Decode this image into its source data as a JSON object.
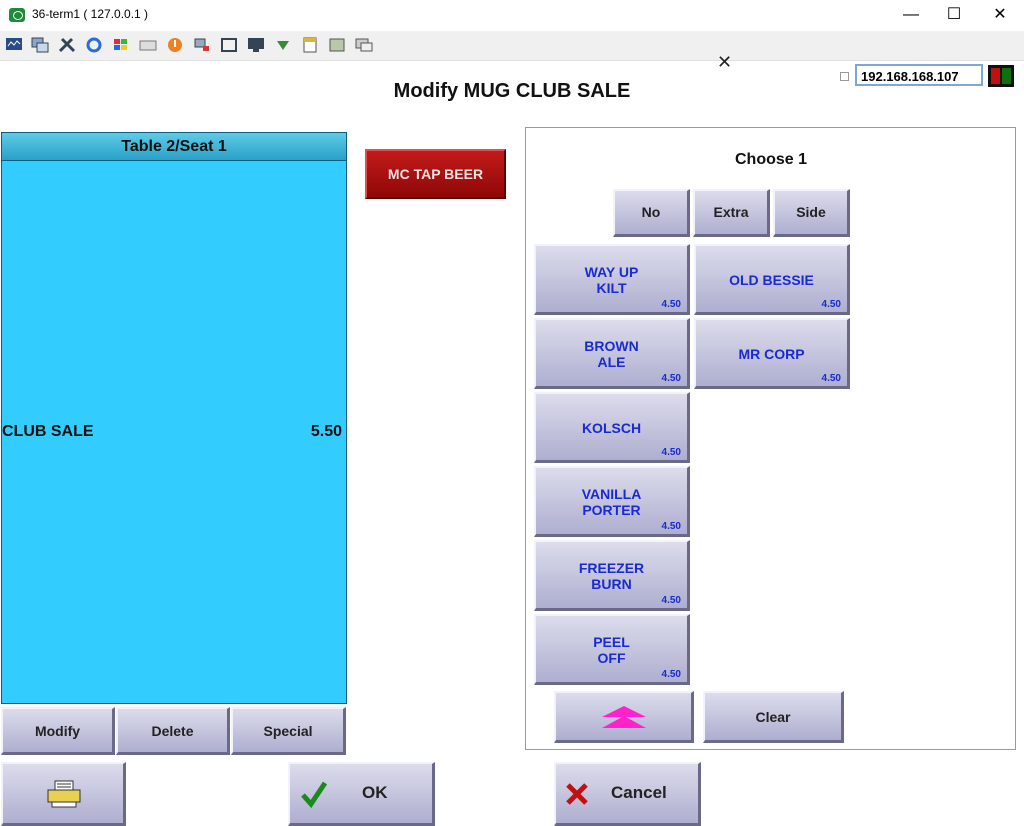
{
  "window": {
    "title": "36-term1 ( 127.0.0.1 )",
    "minimize": "—",
    "maximize": "☐",
    "close": "✕"
  },
  "toolbar": {
    "ip_address": "192.168.168.107"
  },
  "dialog": {
    "title": "Modify MUG CLUB SALE",
    "seat_header": "Table 2/Seat 1",
    "order_item": {
      "name": "CLUB SALE",
      "price": "5.50"
    },
    "left_actions": [
      "Modify",
      "Delete",
      "Special"
    ],
    "category_button": "MC TAP BEER",
    "choose_label": "Choose 1",
    "options": [
      "No",
      "Extra",
      "Side"
    ],
    "modifiers": [
      {
        "name": "WAY UP\nKILT",
        "price": "4.50"
      },
      {
        "name": "OLD BESSIE",
        "price": "4.50"
      },
      {
        "name": "BROWN\nALE",
        "price": "4.50"
      },
      {
        "name": "MR CORP",
        "price": "4.50"
      },
      {
        "name": "KOLSCH",
        "price": "4.50"
      },
      {
        "name": "VANILLA\nPORTER",
        "price": "4.50"
      },
      {
        "name": "FREEZER\nBURN",
        "price": "4.50"
      },
      {
        "name": "PEEL\nOFF",
        "price": "4.50"
      }
    ],
    "clear_label": "Clear",
    "ok_label": "OK",
    "cancel_label": "Cancel"
  },
  "colors": {
    "order_panel": "#33ccff",
    "category_button": "#a00f0f",
    "modifier_text": "#1a2bd0",
    "page_up_arrow": "#ff22cc"
  }
}
